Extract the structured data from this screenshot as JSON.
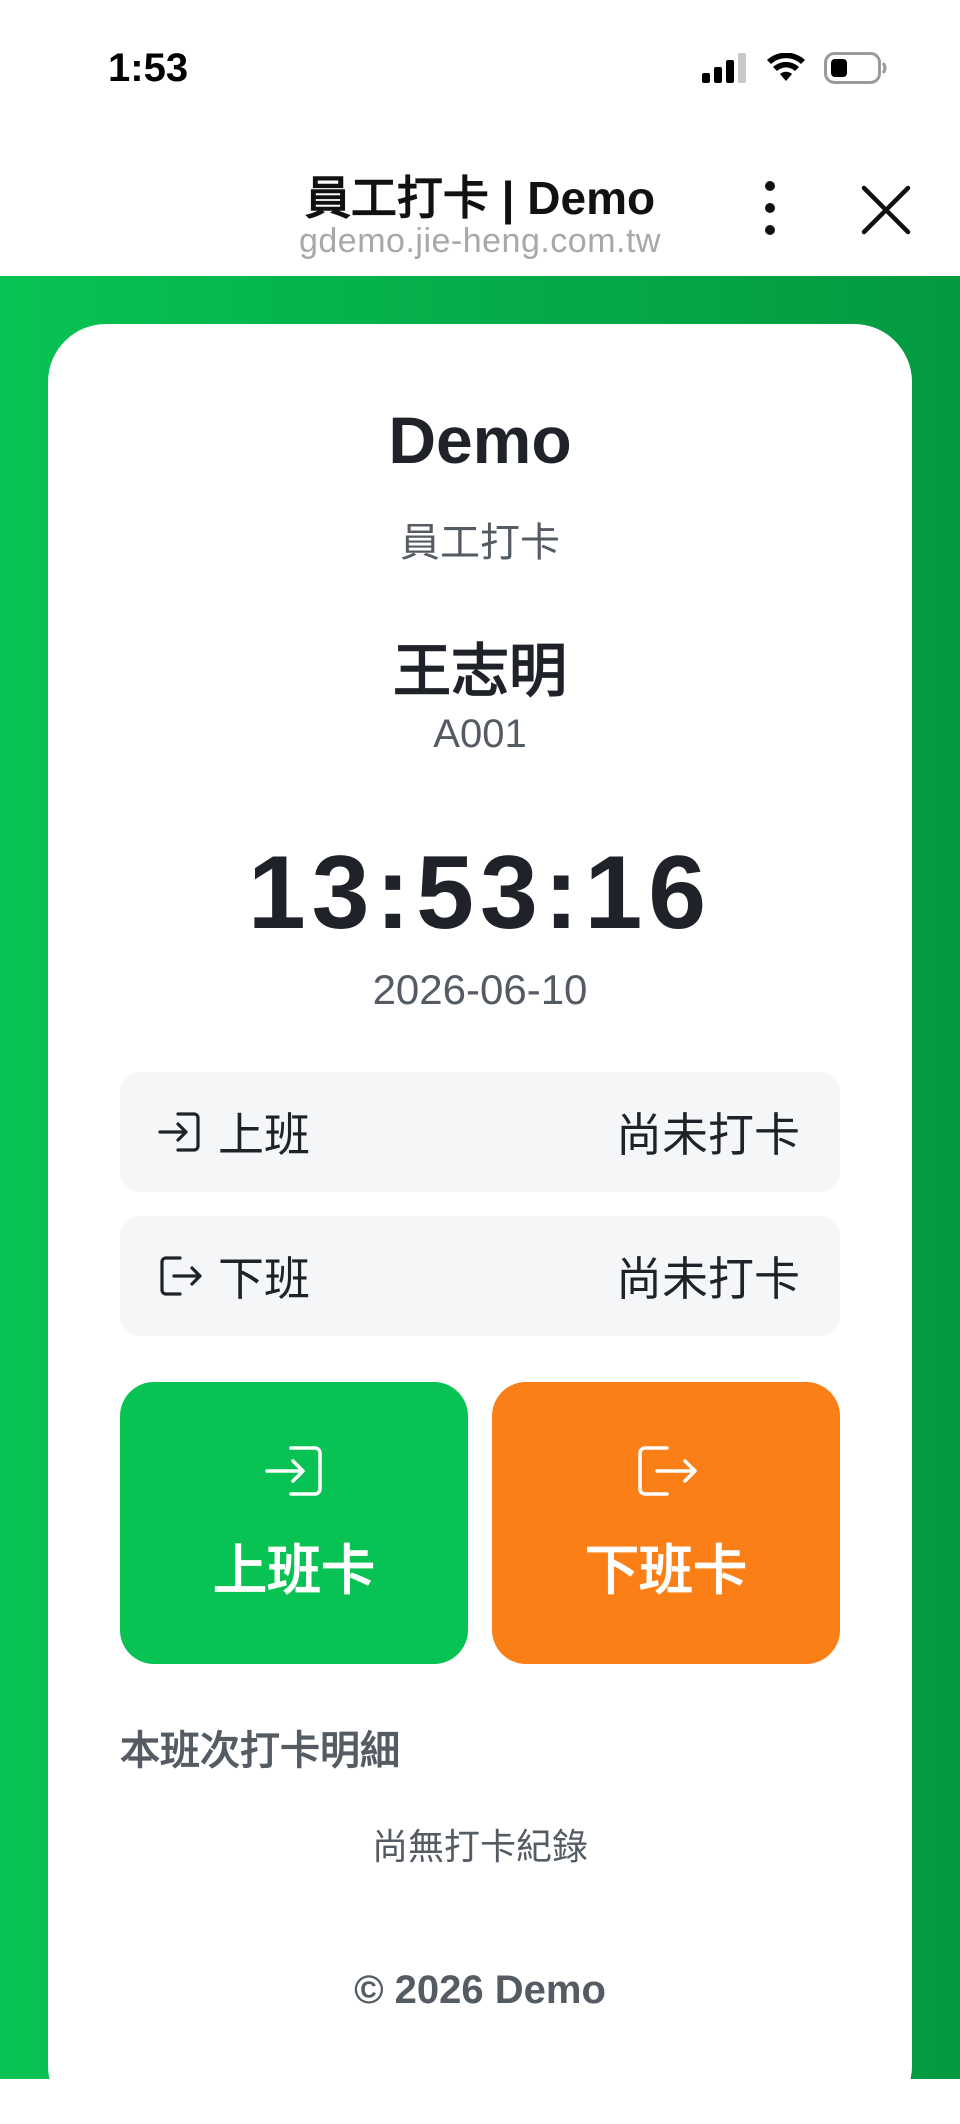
{
  "status_bar": {
    "time": "1:53"
  },
  "browser": {
    "title": "員工打卡 | Demo",
    "url": "gdemo.jie-heng.com.tw"
  },
  "card": {
    "company": "Demo",
    "subtitle": "員工打卡",
    "employee_name": "王志明",
    "employee_id": "A001",
    "clock": "13:53:16",
    "date": "2026-06-10",
    "clock_in_row": {
      "label": "上班",
      "value": "尚未打卡"
    },
    "clock_out_row": {
      "label": "下班",
      "value": "尚未打卡"
    },
    "clock_in_button": "上班卡",
    "clock_out_button": "下班卡",
    "detail_title": "本班次打卡明細",
    "detail_empty": "尚無打卡紀錄",
    "footer": "© 2026 Demo"
  },
  "colors": {
    "green": "#08c353",
    "orange": "#fa7f17",
    "text_dark": "#1f2329",
    "text_muted": "#555b63"
  }
}
